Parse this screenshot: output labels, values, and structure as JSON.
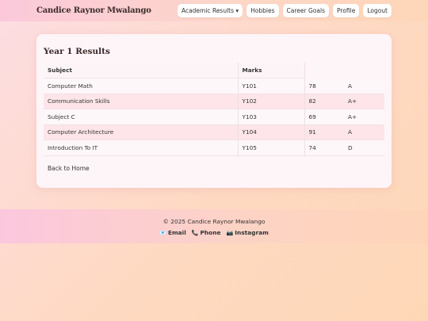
{
  "header": {
    "brand": "Candice Raynor Mwalango",
    "nav": {
      "academic": "Academic Results ▾",
      "hobbies": "Hobbies",
      "career": "Career Goals",
      "profile": "Profile",
      "logout": "Logout"
    }
  },
  "results": {
    "title": "Year 1 Results",
    "columns": {
      "subject": "Subject",
      "marks": "Marks"
    },
    "rows": [
      {
        "subject": "Computer Math",
        "code": "Y101",
        "marks": "78",
        "grade": "A"
      },
      {
        "subject": "Communication Skills",
        "code": "Y102",
        "marks": "82",
        "grade": "A+"
      },
      {
        "subject": "Subject C",
        "code": "Y103",
        "marks": "69",
        "grade": "A+"
      },
      {
        "subject": "Computer Architecture",
        "code": "Y104",
        "marks": "91",
        "grade": "A"
      },
      {
        "subject": "Introduction To IT",
        "code": "Y105",
        "marks": "74",
        "grade": "D"
      }
    ],
    "back_link": "Back to Home"
  },
  "footer": {
    "copyright": "© 2025 Candice Raynor Mwalango",
    "links": {
      "email_icon": "📧",
      "email": "Email",
      "phone_icon": "📞",
      "phone": "Phone",
      "instagram_icon": "📷",
      "instagram": "Instagram"
    }
  },
  "colors": {
    "accent_pink": "#fbc9db",
    "accent_peach": "#fed6b8",
    "row_highlight": "#fde5e9"
  }
}
